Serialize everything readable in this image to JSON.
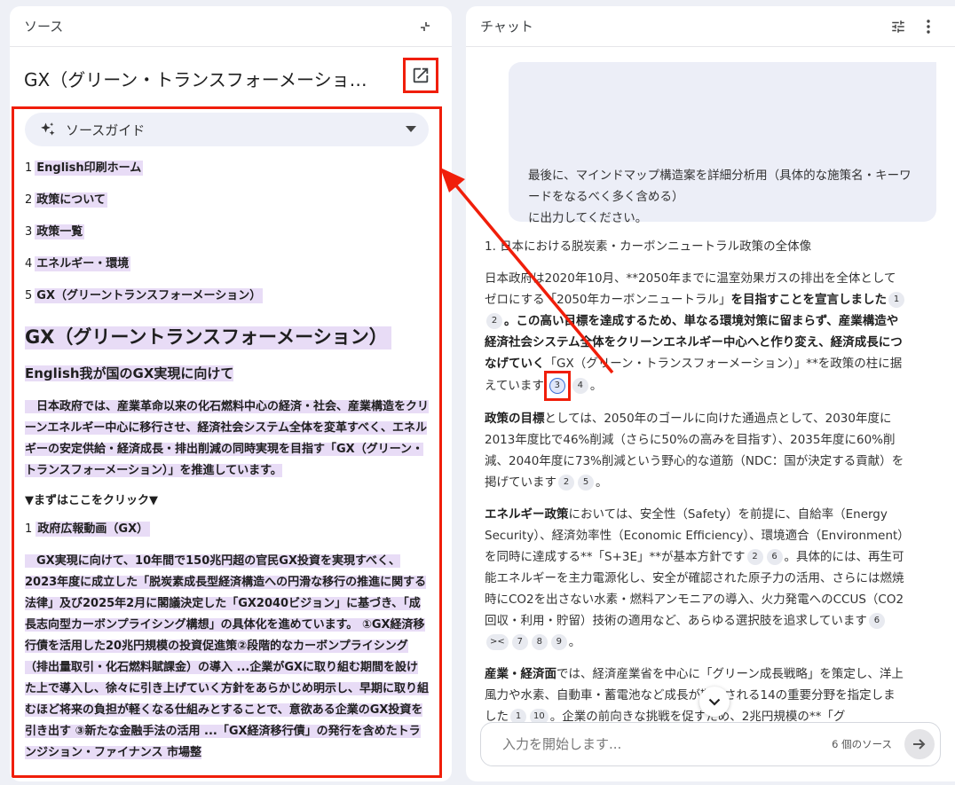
{
  "source_panel": {
    "header_title": "ソース",
    "document_title": "GX（グリーン・トランスフォーメーショ…",
    "guide_label": "ソースガイド",
    "toc": [
      {
        "num": "1",
        "label": "English印刷ホーム"
      },
      {
        "num": "2",
        "label": "政策について"
      },
      {
        "num": "3",
        "label": "政策一覧"
      },
      {
        "num": "4",
        "label": "エネルギー・環境"
      },
      {
        "num": "5",
        "label": "GX（グリーントランスフォーメーション）"
      }
    ],
    "doc_heading": "GX（グリーントランスフォーメーション）",
    "doc_subheading": "English我が国のGX実現に向けて",
    "doc_paragraph_1": "　日本政府では、産業革命以来の化石燃料中心の経済・社会、産業構造をクリーンエネルギー中心に移行させ、経済社会システム全体を変革すべく、エネルギーの安定供給・経済成長・排出削減の同時実現を目指す「GX（グリーン・トランスフォーメーション）」を推進しています。",
    "click_here": "▼まずはここをクリック▼",
    "video_num": "1",
    "video_label": "政府広報動画（GX）",
    "doc_paragraph_2": "　GX実現に向けて、10年間で150兆円超の官民GX投資を実現すべく、2023年度に成立した「脱炭素成長型経済構造への円滑な移行の推進に関する法律」及び2025年2月に閣議決定した「GX2040ビジョン」に基づき、「成長志向型カーボンプライシング構想」の具体化を進めています。 ①GX経済移行債を活用した20兆円規模の投資促進策②段階的なカーボンプライシング（排出量取引・化石燃料賦課金）の導入 ...企業がGXに取り組む期間を設けた上で導入し、徐々に引き上げていく方針をあらかじめ明示し、早期に取り組むほど将来の負担が軽くなる仕組みとすることで、意欲ある企業のGX投資を引き出す ③新たな金融手法の活用 ...「GX経済移行債」の発行を含めたトランジション・ファイナンス 市場整"
  },
  "chat_panel": {
    "header_title": "チャット",
    "user_message_line_1": "最後に、マインドマップ構造案を詳細分析用（具体的な施策名・キーワードをなるべく多く含める）",
    "user_message_line_2": "に出力してください。",
    "answer": {
      "heading": "1. 日本における脱炭素・カーボンニュートラル政策の全体像",
      "p1_a": "日本政府は2020年10月、**2050年までに温室効果ガスの排出を全体としてゼロにする「2050年カーボンニュートラル」",
      "p1_b": "を目指すことを宣言しました",
      "p1_cites_1": [
        "1",
        "2"
      ],
      "p1_c": "。この高い目標を達成するため、単なる環境対策に留まらず、産業構造や経済社会システム全体をクリーンエネルギー中心へと作り変え、経済成長につなげていく",
      "p1_d": "「GX（グリーン・トランスフォーメーション）」**を政策の柱に据えています",
      "p1_cite_highlighted": "3",
      "p1_cite_after": "4",
      "p2_label": "政策の目標",
      "p2_text": "としては、2050年のゴールに向けた通過点として、2030年度に2013年度比で46%削減（さらに50%の高みを目指す）、2035年度に60%削減、2040年度に73%削減という野心的な道筋（NDC：国が決定する貢献）を掲げています",
      "p2_cites": [
        "2",
        "5"
      ],
      "p3_label": "エネルギー政策",
      "p3_text_a": "においては、安全性（Safety）を前提に、自給率（Energy Security）、経済効率性（Economic Efficiency）、環境適合（Environment）を同時に達成する**「S+3E」**が基本方針です",
      "p3_cites_1": [
        "2",
        "6"
      ],
      "p3_text_b": "。具体的には、再生可能エネルギーを主力電源化し、安全が確認された原子力の活用、さらには燃焼時にCO2を出さない水素・燃料アンモニアの導入、火力発電へのCCUS（CO2回収・利用・貯留）技術の適用など、あらゆる選択肢を追求しています",
      "p3_cites_2": [
        "6",
        "><",
        "7",
        "8",
        "9"
      ],
      "p4_label": "産業・経済面",
      "p4_text_a": "では、経済産業省を中心に「グリーン成長戦略」を策定し、洋上風力や水素、自動車・蓄電池など成長が期待される14の重要分野を指定しました",
      "p4_cites": [
        "1",
        "10"
      ],
      "p4_text_b": "。企業の前向きな挑戦を促すため、2兆円規模の**「グ"
    },
    "composer_placeholder": "入力を開始します...",
    "source_count": "6 個のソース"
  },
  "colors": {
    "highlight": "#e8dcf6",
    "annotation_red": "#f01e0a",
    "background": "#eef0f6"
  },
  "icons": [
    "collapse-icon",
    "open-external-icon",
    "sparkle-icon",
    "dropdown-icon",
    "tune-icon",
    "more-vert-icon",
    "chevron-down-icon",
    "send-arrow-icon"
  ]
}
